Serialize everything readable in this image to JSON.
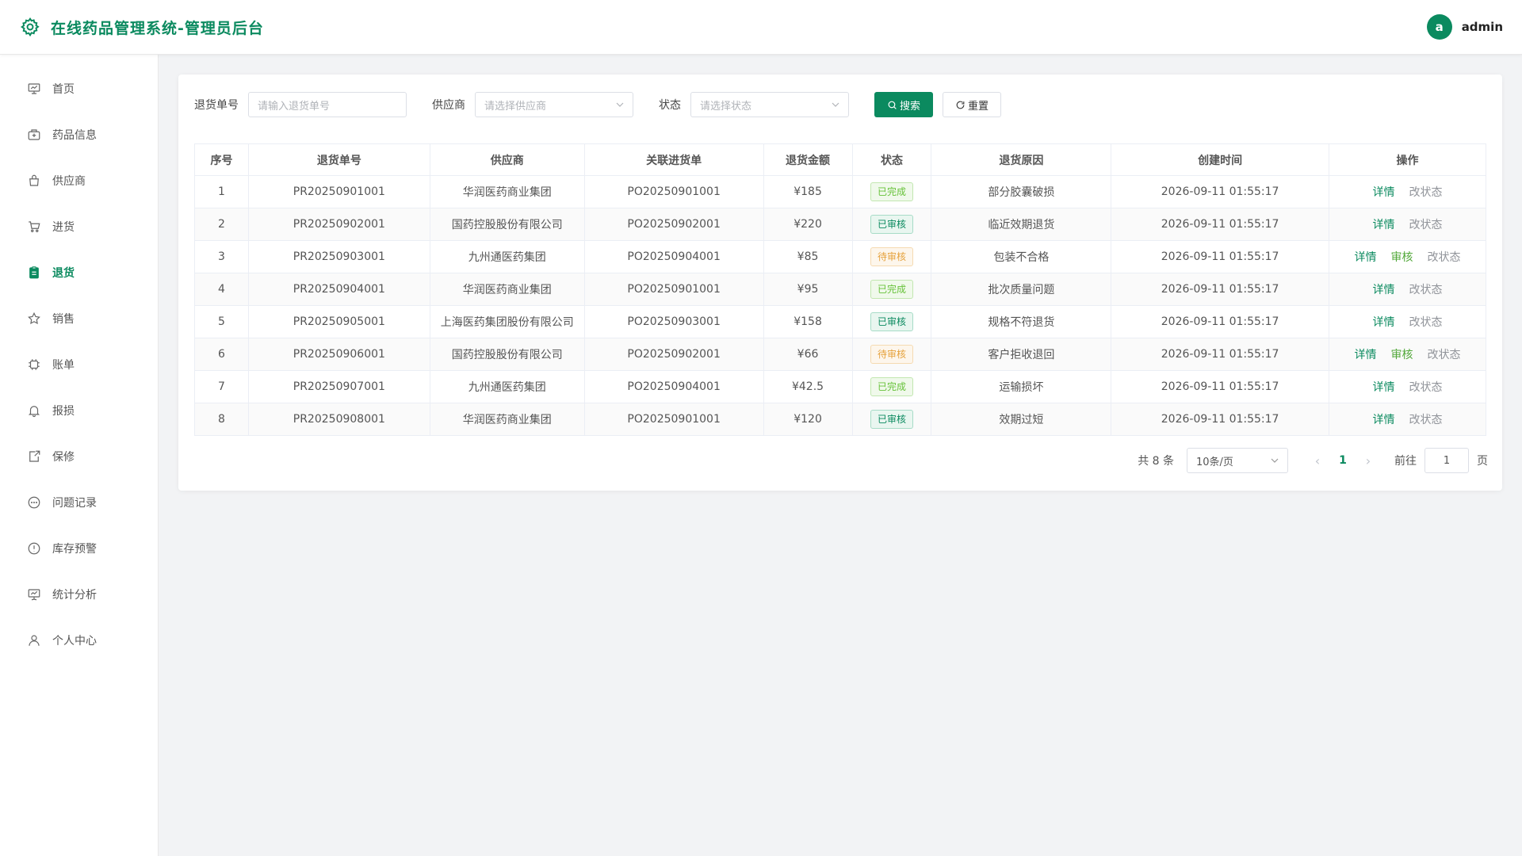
{
  "header": {
    "title": "在线药品管理系统-管理员后台",
    "avatar_letter": "a",
    "username": "admin",
    "brand_color": "#0b8a5f"
  },
  "sidebar": {
    "items": [
      {
        "label": "首页",
        "icon": "dashboard-icon",
        "active": false
      },
      {
        "label": "药品信息",
        "icon": "medicine-box-icon",
        "active": false
      },
      {
        "label": "供应商",
        "icon": "bag-icon",
        "active": false
      },
      {
        "label": "进货",
        "icon": "cart-icon",
        "active": false
      },
      {
        "label": "退货",
        "icon": "clipboard-icon",
        "active": true
      },
      {
        "label": "销售",
        "icon": "star-icon",
        "active": false
      },
      {
        "label": "账单",
        "icon": "chip-icon",
        "active": false
      },
      {
        "label": "报损",
        "icon": "bell-icon",
        "active": false
      },
      {
        "label": "保修",
        "icon": "shield-doc-icon",
        "active": false
      },
      {
        "label": "问题记录",
        "icon": "chat-icon",
        "active": false
      },
      {
        "label": "库存预警",
        "icon": "warning-icon",
        "active": false
      },
      {
        "label": "统计分析",
        "icon": "presentation-icon",
        "active": false
      },
      {
        "label": "个人中心",
        "icon": "user-icon",
        "active": false
      }
    ]
  },
  "filters": {
    "return_no_label": "退货单号",
    "return_no_placeholder": "请输入退货单号",
    "supplier_label": "供应商",
    "supplier_placeholder": "请选择供应商",
    "status_label": "状态",
    "status_placeholder": "请选择状态",
    "search_label": "搜索",
    "reset_label": "重置"
  },
  "table": {
    "columns": [
      "序号",
      "退货单号",
      "供应商",
      "关联进货单",
      "退货金额",
      "状态",
      "退货原因",
      "创建时间",
      "操作"
    ],
    "rows": [
      {
        "index": "1",
        "return_no": "PR20250901001",
        "supplier": "华润医药商业集团",
        "purchase_no": "PO20250901001",
        "amount": "¥185",
        "status": "已完成",
        "status_type": "done",
        "reason": "部分胶囊破损",
        "created": "2026-09-11 01:55:17",
        "actions": [
          "详情",
          "改状态"
        ]
      },
      {
        "index": "2",
        "return_no": "PR20250902001",
        "supplier": "国药控股股份有限公司",
        "purchase_no": "PO20250902001",
        "amount": "¥220",
        "status": "已审核",
        "status_type": "approved",
        "reason": "临近效期退货",
        "created": "2026-09-11 01:55:17",
        "actions": [
          "详情",
          "改状态"
        ]
      },
      {
        "index": "3",
        "return_no": "PR20250903001",
        "supplier": "九州通医药集团",
        "purchase_no": "PO20250904001",
        "amount": "¥85",
        "status": "待审核",
        "status_type": "pending",
        "reason": "包装不合格",
        "created": "2026-09-11 01:55:17",
        "actions": [
          "详情",
          "审核",
          "改状态"
        ]
      },
      {
        "index": "4",
        "return_no": "PR20250904001",
        "supplier": "华润医药商业集团",
        "purchase_no": "PO20250901001",
        "amount": "¥95",
        "status": "已完成",
        "status_type": "done",
        "reason": "批次质量问题",
        "created": "2026-09-11 01:55:17",
        "actions": [
          "详情",
          "改状态"
        ]
      },
      {
        "index": "5",
        "return_no": "PR20250905001",
        "supplier": "上海医药集团股份有限公司",
        "purchase_no": "PO20250903001",
        "amount": "¥158",
        "status": "已审核",
        "status_type": "approved",
        "reason": "规格不符退货",
        "created": "2026-09-11 01:55:17",
        "actions": [
          "详情",
          "改状态"
        ]
      },
      {
        "index": "6",
        "return_no": "PR20250906001",
        "supplier": "国药控股股份有限公司",
        "purchase_no": "PO20250902001",
        "amount": "¥66",
        "status": "待审核",
        "status_type": "pending",
        "reason": "客户拒收退回",
        "created": "2026-09-11 01:55:17",
        "actions": [
          "详情",
          "审核",
          "改状态"
        ]
      },
      {
        "index": "7",
        "return_no": "PR20250907001",
        "supplier": "九州通医药集团",
        "purchase_no": "PO20250904001",
        "amount": "¥42.5",
        "status": "已完成",
        "status_type": "done",
        "reason": "运输损坏",
        "created": "2026-09-11 01:55:17",
        "actions": [
          "详情",
          "改状态"
        ]
      },
      {
        "index": "8",
        "return_no": "PR20250908001",
        "supplier": "华润医药商业集团",
        "purchase_no": "PO20250901001",
        "amount": "¥120",
        "status": "已审核",
        "status_type": "approved",
        "reason": "效期过短",
        "created": "2026-09-11 01:55:17",
        "actions": [
          "详情",
          "改状态"
        ]
      }
    ],
    "status_colors": {
      "done": {
        "text": "#67c23a",
        "border": "#c2e7b0",
        "bg": "#f0f9eb"
      },
      "approved": {
        "text": "#0b8a5f",
        "border": "#a7dcc7",
        "bg": "#e9f6f0"
      },
      "pending": {
        "text": "#e6a23c",
        "border": "#f5dab1",
        "bg": "#fdf6ec"
      }
    }
  },
  "pagination": {
    "total_text": "共 8 条",
    "page_size": "10条/页",
    "current_page": "1",
    "goto_label": "前往",
    "goto_value": "1",
    "page_suffix": "页"
  }
}
